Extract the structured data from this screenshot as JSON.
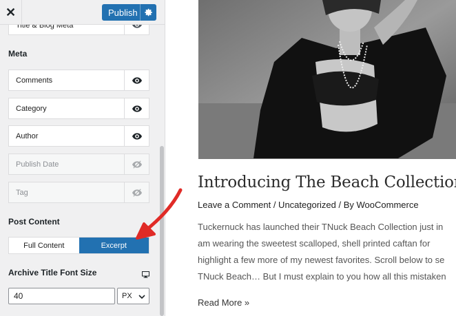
{
  "header": {
    "close_label": "✕",
    "publish_label": "Publish"
  },
  "panel": {
    "partial_item": "Title & Blog Meta",
    "meta_section": "Meta",
    "meta_items": [
      {
        "label": "Comments",
        "visible": true
      },
      {
        "label": "Category",
        "visible": true
      },
      {
        "label": "Author",
        "visible": true
      },
      {
        "label": "Publish Date",
        "visible": false
      },
      {
        "label": "Tag",
        "visible": false
      }
    ],
    "post_content_section": "Post Content",
    "post_content_options": [
      "Full Content",
      "Excerpt"
    ],
    "post_content_selected": "Excerpt",
    "font_size_label": "Archive Title Font Size",
    "font_size_value": "40",
    "font_size_unit": "PX"
  },
  "preview": {
    "post_title": "Introducing The Beach Collection",
    "post_meta": "Leave a Comment / Uncategorized / By WooCommerce",
    "excerpt_lines": [
      "Tuckernuck has launched their TNuck Beach Collection just in",
      "am wearing the sweetest scalloped, shell printed caftan for",
      "highlight a few more of my newest favorites. Scroll below to se",
      "TNuck Beach… But I must explain to you how all this mistaken"
    ],
    "read_more": "Read More »"
  },
  "colors": {
    "accent": "#2271b1",
    "annotation_arrow": "#e02b27"
  }
}
